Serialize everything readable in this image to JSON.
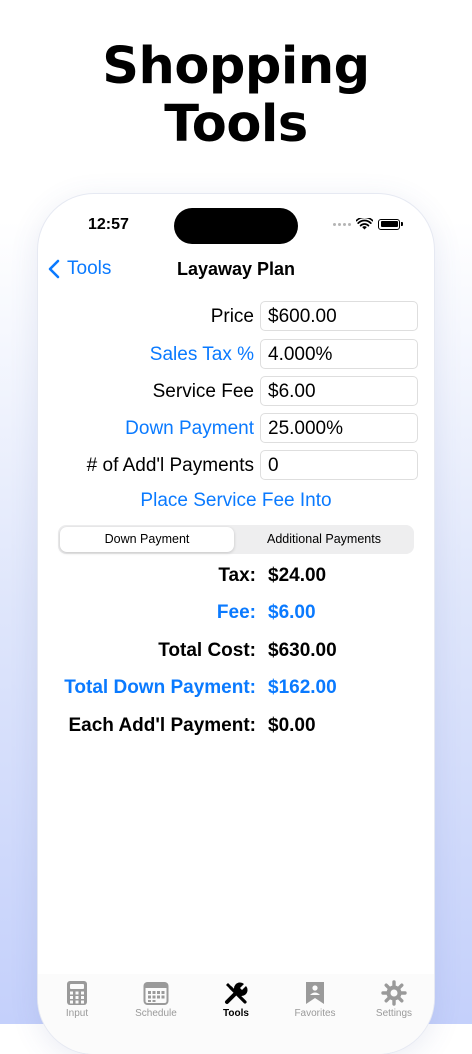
{
  "headline": {
    "line1": "Shopping",
    "line2": "Tools"
  },
  "status_bar": {
    "time": "12:57"
  },
  "nav": {
    "back_label": "Tools",
    "title": "Layaway Plan"
  },
  "form": [
    {
      "label": "Price",
      "value": "$600.00",
      "label_color": "#000000"
    },
    {
      "label": "Sales Tax %",
      "value": "4.000%",
      "label_color": "#0a7aff"
    },
    {
      "label": "Service Fee",
      "value": "$6.00",
      "label_color": "#000000"
    },
    {
      "label": "Down Payment",
      "value": "25.000%",
      "label_color": "#0a7aff"
    },
    {
      "label": "# of Add'l Payments",
      "value": "0",
      "label_color": "#000000"
    }
  ],
  "place_fee_label": "Place Service Fee Into",
  "segments": {
    "selected": "Down Payment",
    "other": "Additional Payments"
  },
  "results": [
    {
      "label": "Tax:",
      "value": "$24.00"
    },
    {
      "label": "Fee:",
      "value": "$6.00"
    },
    {
      "label": "Total Cost:",
      "value": "$630.00"
    },
    {
      "label": "Total Down Payment:",
      "value": "$162.00"
    },
    {
      "label": "Each Add'l Payment:",
      "value": "$0.00"
    }
  ],
  "tabs": [
    {
      "label": "Input",
      "icon": "calculator-icon"
    },
    {
      "label": "Schedule",
      "icon": "calendar-icon"
    },
    {
      "label": "Tools",
      "icon": "tools-icon",
      "active": true
    },
    {
      "label": "Favorites",
      "icon": "bookmark-icon"
    },
    {
      "label": "Settings",
      "icon": "gear-icon"
    }
  ],
  "colors": {
    "accent": "#0a7aff",
    "inactive_tab": "#9a9a9a"
  }
}
